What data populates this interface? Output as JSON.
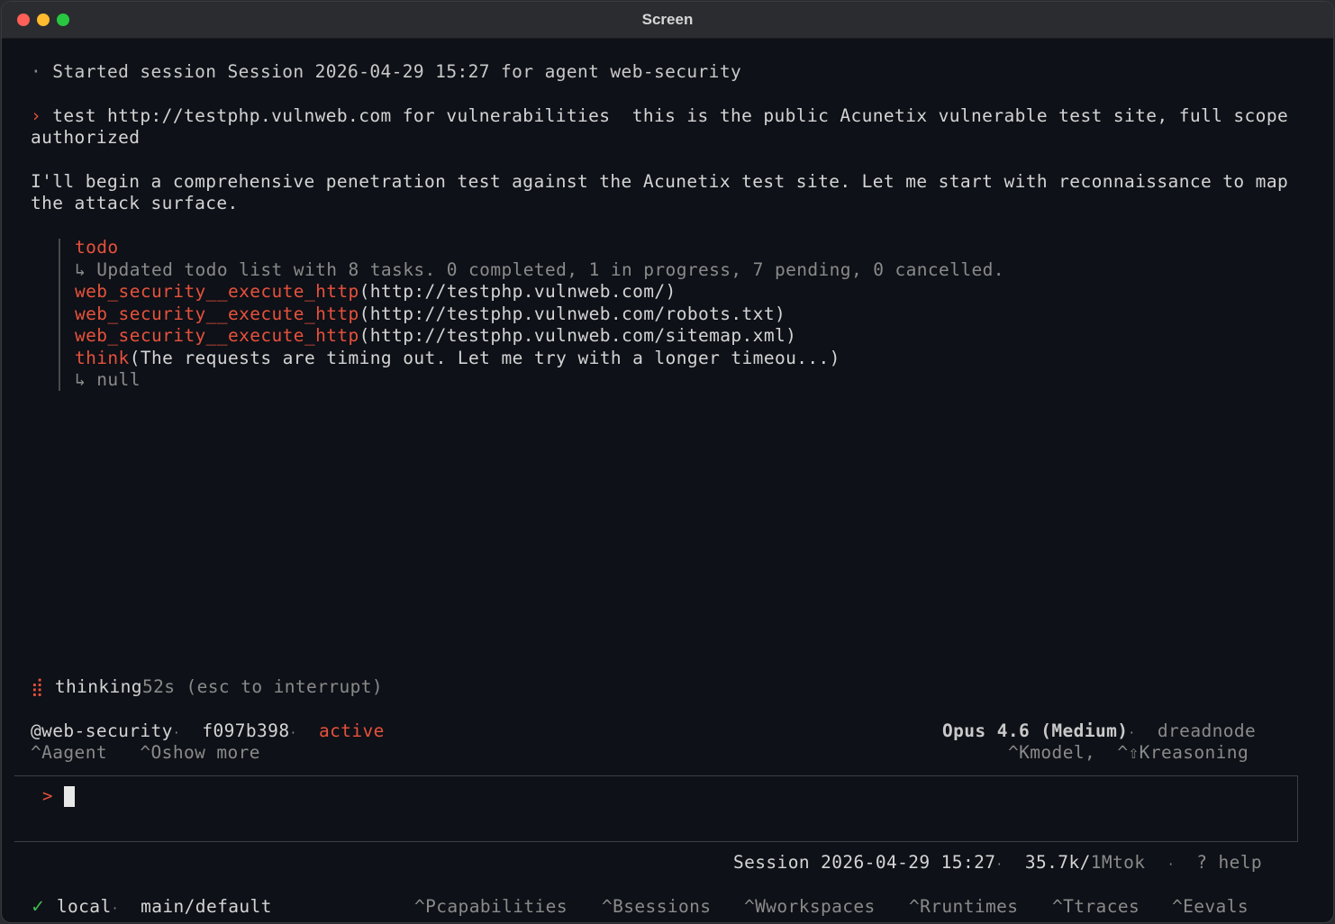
{
  "window": {
    "title": "Screen"
  },
  "session_line": {
    "bullet": "·",
    "text": "Started session Session 2026-04-29 15:27 for agent web-security"
  },
  "user_prompt": {
    "marker": "›",
    "line1": "test http://testphp.vulnweb.com for vulnerabilities  this is the public Acunetix vulnerable test site, full scope",
    "line2": "authorized"
  },
  "assistant_message": {
    "line1": "I'll begin a comprehensive penetration test against the Acunetix test site. Let me start with reconnaissance to map",
    "line2": "the attack surface."
  },
  "tool_calls": {
    "todo_name": "todo",
    "todo_result": "↳ Updated todo list with 8 tasks. 0 completed, 1 in progress, 7 pending, 0 cancelled.",
    "calls": [
      {
        "name": "web_security__execute_http",
        "args": "(http://testphp.vulnweb.com/)"
      },
      {
        "name": "web_security__execute_http",
        "args": "(http://testphp.vulnweb.com/robots.txt)"
      },
      {
        "name": "web_security__execute_http",
        "args": "(http://testphp.vulnweb.com/sitemap.xml)"
      }
    ],
    "think_name": "think",
    "think_args": "(The requests are timing out. Let me try with a longer timeou...)",
    "think_result": "↳ null"
  },
  "thinking": {
    "spinner": "⣾",
    "label": "thinking",
    "elapsed": "52s",
    "hint": "(esc to interrupt)"
  },
  "status_left": {
    "agent": "@web-security",
    "sep1": "·",
    "commit": "f097b398",
    "sep2": "·",
    "state": "active",
    "shortcut_agent": "^Aagent",
    "shortcut_more": "^Oshow more"
  },
  "status_right": {
    "model": "Opus 4.6 (Medium)",
    "sep": "·",
    "provider": "dreadnode",
    "shortcut_model": "^Kmodel,",
    "shortcut_reasoning": "^⇧Kreasoning"
  },
  "input": {
    "prompt": ">"
  },
  "footer_session": {
    "session": "Session 2026-04-29 15:27",
    "sep1": "·",
    "tokens": "35.7k/",
    "token_limit": "1Mtok",
    "sep2": "·",
    "help": "? help"
  },
  "footer_bar": {
    "check": "✓",
    "env": "local",
    "sep": "·",
    "branch": "main/default",
    "items": [
      "^Pcapabilities",
      "^Bsessions",
      "^Wworkspaces",
      "^Rruntimes",
      "^Ttraces",
      "^Eevals"
    ]
  },
  "colors": {
    "accent": "#e7513c",
    "background": "#0e1117",
    "text": "#d4d4d4",
    "muted": "#8a8a8a"
  }
}
